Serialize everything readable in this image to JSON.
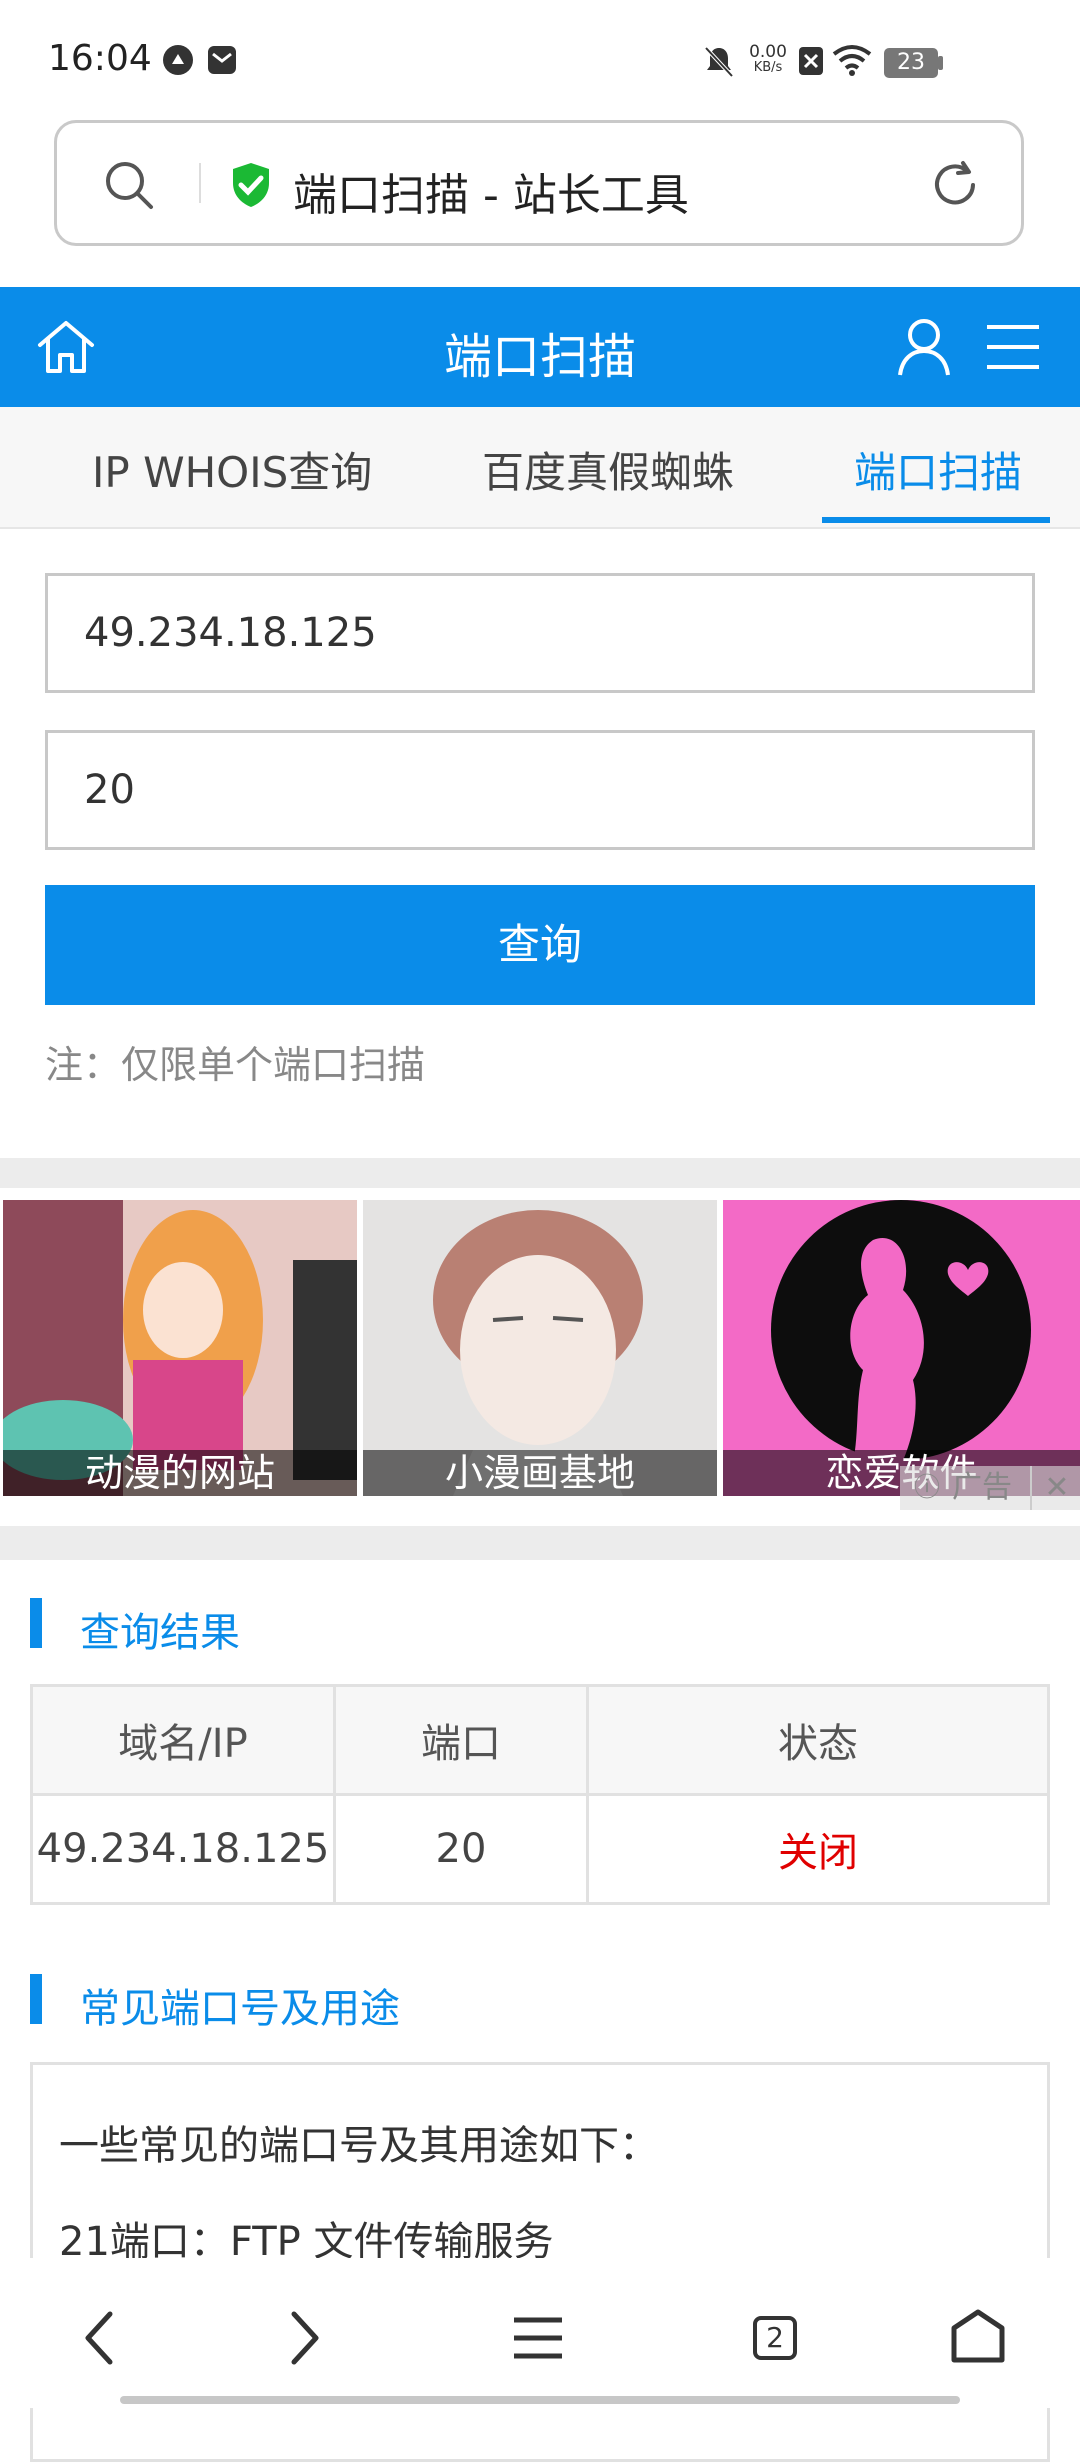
{
  "status_bar": {
    "time": "16:04",
    "net_speed_value": "0.00",
    "net_speed_unit": "KB/s",
    "battery": "23"
  },
  "address_bar": {
    "title": "端口扫描 - 站长工具"
  },
  "header": {
    "title": "端口扫描"
  },
  "tabs": [
    {
      "label": "IP WHOIS查询",
      "active": false
    },
    {
      "label": "百度真假蜘蛛",
      "active": false
    },
    {
      "label": "端口扫描",
      "active": true
    }
  ],
  "form": {
    "ip_value": "49.234.18.125",
    "port_value": "20",
    "query_label": "查询",
    "note": "注：仅限单个端口扫描"
  },
  "ads": {
    "items": [
      {
        "caption": "动漫的网站"
      },
      {
        "caption": "小漫画基地"
      },
      {
        "caption": "恋爱软件"
      }
    ],
    "badge": "广告"
  },
  "results": {
    "section_title": "查询结果",
    "columns": [
      "域名/IP",
      "端口",
      "状态"
    ],
    "rows": [
      {
        "host": "49.234.18.125",
        "port": "20",
        "status": "关闭"
      }
    ]
  },
  "ports_info": {
    "section_title": "常见端口号及用途",
    "intro": "一些常见的端口号及其用途如下：",
    "lines": [
      "21端口：FTP 文件传输服务"
    ]
  },
  "bottom_nav": {
    "tab_count": "2"
  },
  "colors": {
    "accent": "#0a8ce9",
    "status_closed": "#e00000"
  }
}
